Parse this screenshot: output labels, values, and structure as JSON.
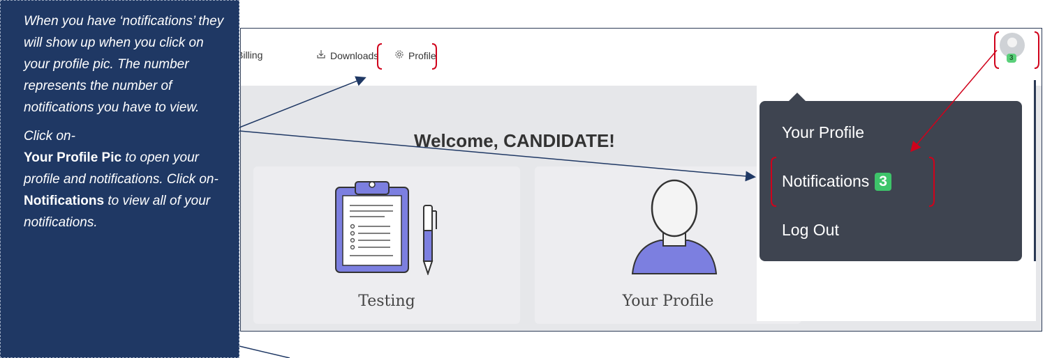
{
  "callout": {
    "intro": "When you have ‘notifications’ they will show up when you click on your profile pic. The number represents the number of notifications you have to view.",
    "click_on_1": "Click on-",
    "profile_pic_label": "Your Profile Pic",
    "profile_pic_desc": "to open your profile and notifications. Click on-",
    "notifications_label": "Notifications",
    "notifications_desc": "to view all of your notifications."
  },
  "nav": {
    "billing": "Billing",
    "downloads": "Downloads",
    "profile": "Profile",
    "avatar_badge": "3"
  },
  "main": {
    "welcome": "Welcome, CANDIDATE!",
    "cards": {
      "testing": "Testing",
      "your_profile": "Your Profile"
    }
  },
  "dropdown": {
    "your_profile": "Your Profile",
    "notifications": "Notifications",
    "notifications_count": "3",
    "log_out": "Log Out"
  },
  "colors": {
    "callout_bg": "#1f3864",
    "highlight": "#d0021b",
    "dropdown_bg": "#3e4450",
    "badge": "#3ec46a",
    "card_accent": "#7c7fe0"
  },
  "icons": [
    "downloads-icon",
    "gear-icon",
    "avatar-icon",
    "clipboard-icon",
    "pen-icon",
    "person-icon"
  ]
}
